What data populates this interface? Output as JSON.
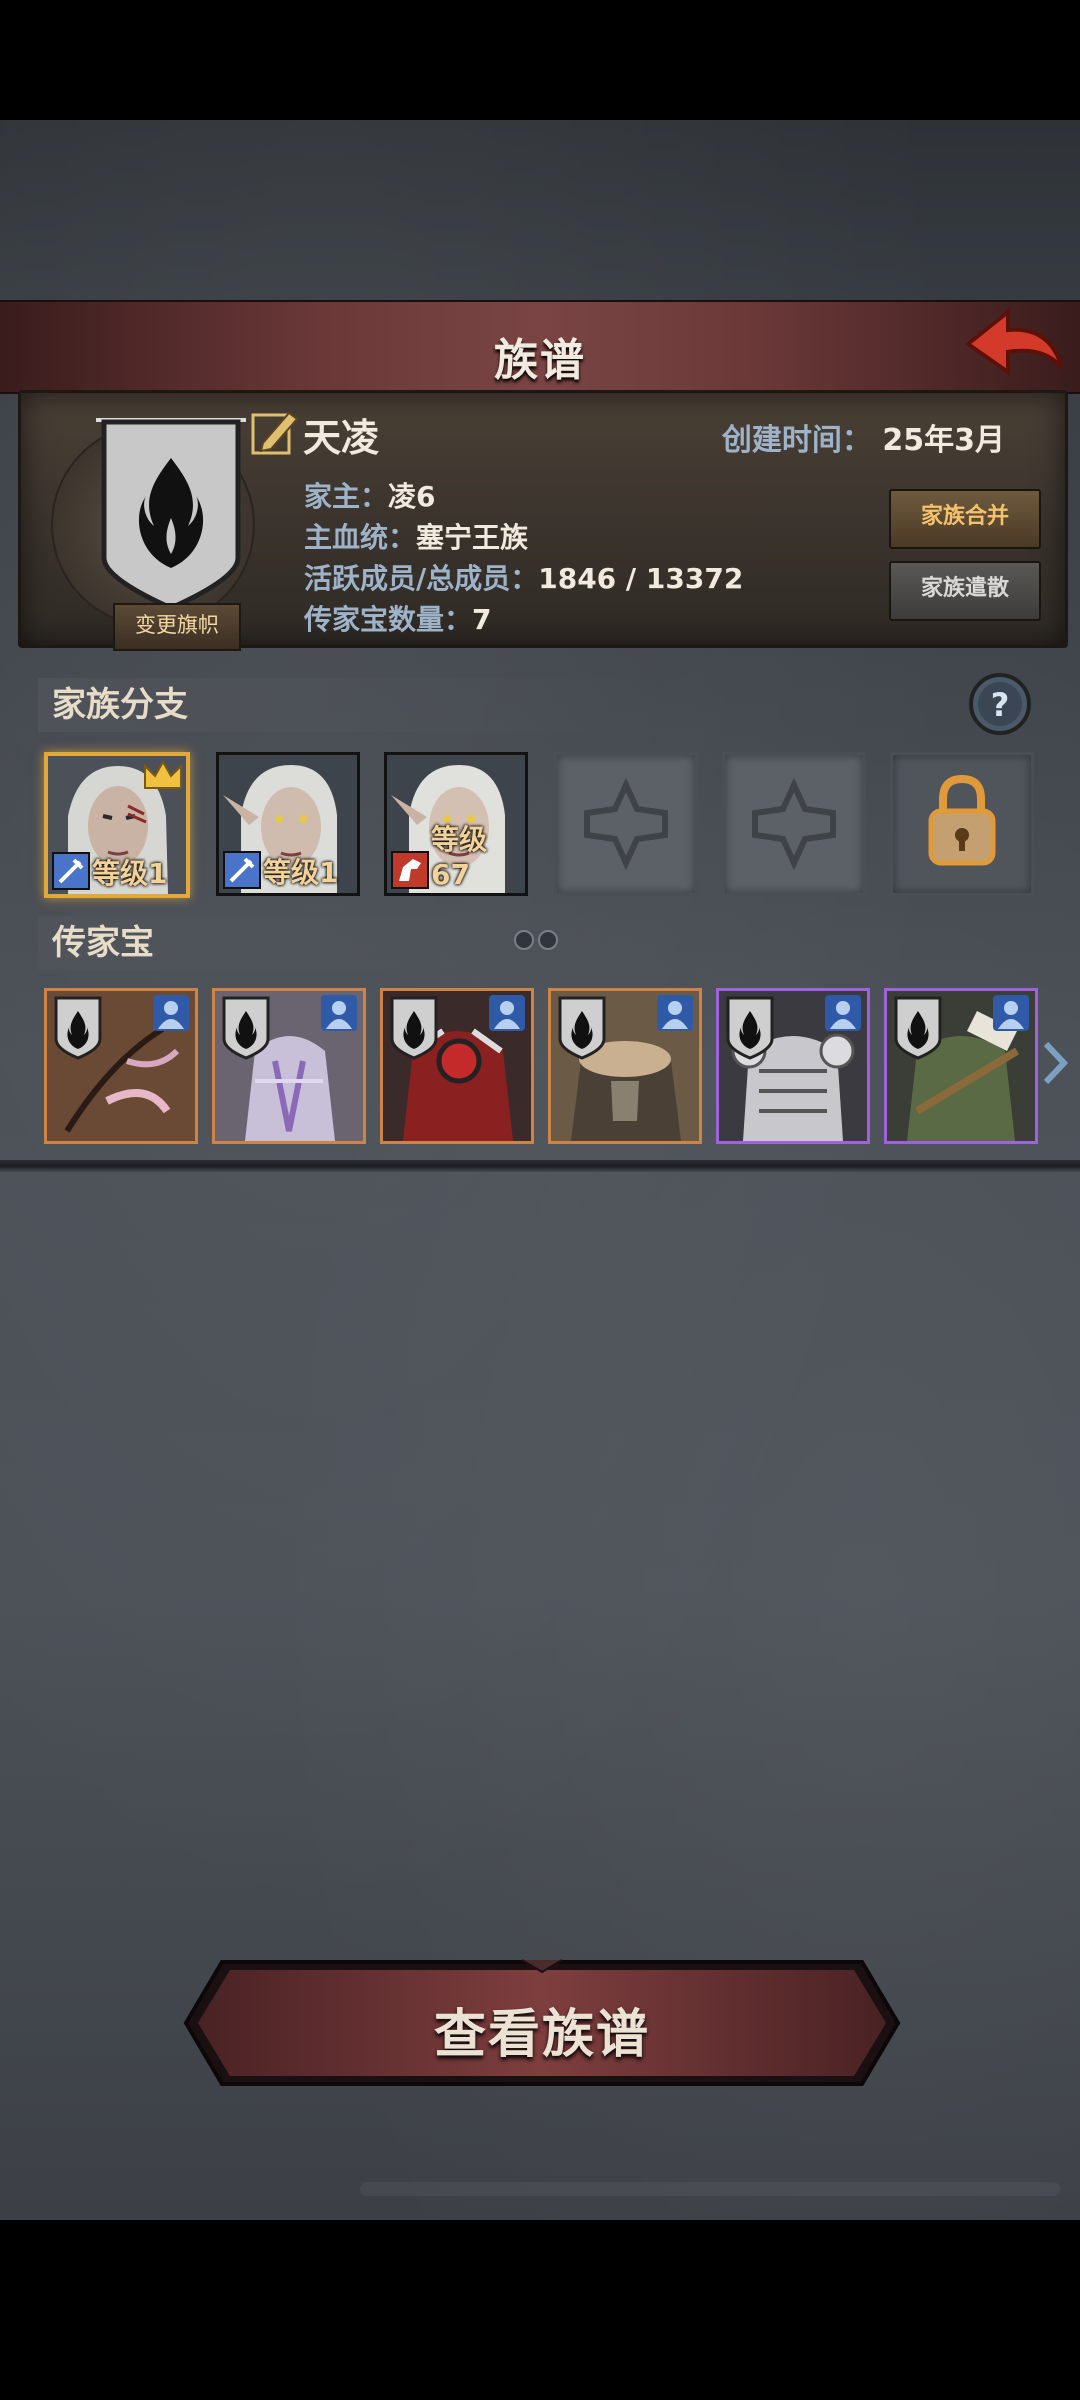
{
  "header": {
    "title": "族谱"
  },
  "clan": {
    "name": "天凌",
    "created_label": "创建时间：",
    "created_value": "25年3月",
    "head_label": "家主：",
    "head_value": "凌6",
    "bloodline_label": "主血统：",
    "bloodline_value": "塞宁王族",
    "members_label": "活跃成员/总成员：",
    "members_value": "1846 / 13372",
    "heirloom_count_label": "传家宝数量：",
    "heirloom_count_value": "7",
    "change_flag_label": "变更旗帜",
    "merge_label": "家族合并",
    "disband_label": "家族遣散"
  },
  "branches": {
    "section_label": "家族分支",
    "members": [
      {
        "level": "等级1",
        "leader": true,
        "role_icon": "sword-icon",
        "badge_color": "#4a74c9"
      },
      {
        "level": "等级1",
        "leader": false,
        "role_icon": "sword-icon",
        "badge_color": "#4a74c9"
      },
      {
        "level": "等级67",
        "leader": false,
        "role_icon": "horse-icon",
        "badge_color": "#c0392b"
      }
    ]
  },
  "heirlooms": {
    "section_label": "传家宝",
    "items": [
      {
        "name": "bow",
        "rarity": "legendary"
      },
      {
        "name": "armor-crystal",
        "rarity": "legendary"
      },
      {
        "name": "crimson-armor",
        "rarity": "legendary"
      },
      {
        "name": "fur-armor",
        "rarity": "legendary"
      },
      {
        "name": "plate-armor",
        "rarity": "epic"
      },
      {
        "name": "green-cloak",
        "rarity": "epic"
      }
    ]
  },
  "footer": {
    "view_button_label": "查看族谱"
  },
  "colors": {
    "legendary_border": "#d08444",
    "epic_border": "#a060e0",
    "accent_gold": "#e2a83a"
  }
}
